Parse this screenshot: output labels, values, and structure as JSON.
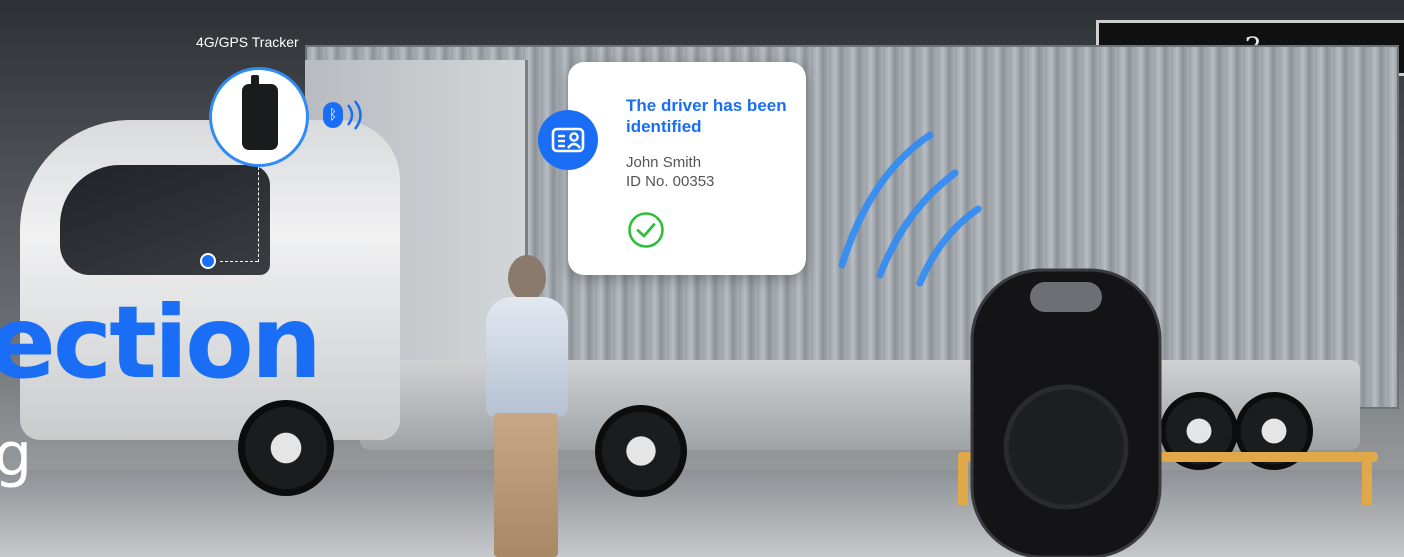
{
  "hero": {
    "headline_fragment": "ection",
    "subline_fragment": "g"
  },
  "tracker": {
    "label": "4G/GPS Tracker"
  },
  "driver_card": {
    "title": "The driver has been identified",
    "name": "John Smith",
    "id_number": "ID  No. 00353"
  },
  "background_sign": {
    "text": "3"
  },
  "colors": {
    "accent_blue": "#1a6ef5",
    "success_green": "#2fbf3b",
    "card_bg": "#ffffff"
  },
  "icons": {
    "tracker_icon": "gps-tracker-icon",
    "bluetooth_icon": "bluetooth-icon",
    "id_card_icon": "id-card-icon",
    "check_icon": "check-circle-icon",
    "signal_icon": "signal-waves-icon",
    "fob_icon": "bluetooth-tag-icon"
  }
}
